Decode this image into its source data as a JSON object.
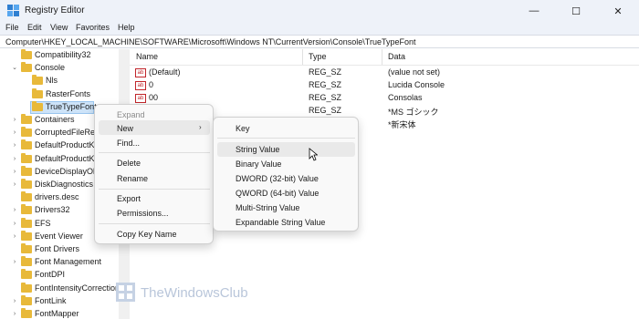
{
  "window": {
    "title": "Registry Editor",
    "minimize": "—",
    "maximize": "☐",
    "close": "✕"
  },
  "menu": {
    "file": "File",
    "edit": "Edit",
    "view": "View",
    "favorites": "Favorites",
    "help": "Help"
  },
  "address": "Computer\\HKEY_LOCAL_MACHINE\\SOFTWARE\\Microsoft\\Windows NT\\CurrentVersion\\Console\\TrueTypeFont",
  "tree": [
    {
      "label": "Compatibility32",
      "expander": "",
      "indent": 1,
      "selected": false
    },
    {
      "label": "Console",
      "expander": "open",
      "indent": 1,
      "selected": false
    },
    {
      "label": "Nls",
      "expander": "",
      "indent": 2,
      "selected": false
    },
    {
      "label": "RasterFonts",
      "expander": "",
      "indent": 2,
      "selected": false
    },
    {
      "label": "TrueTypeFont",
      "expander": "",
      "indent": 2,
      "selected": true
    },
    {
      "label": "Containers",
      "expander": "closed",
      "indent": 1,
      "selected": false
    },
    {
      "label": "CorruptedFileRe",
      "expander": "closed",
      "indent": 1,
      "selected": false
    },
    {
      "label": "DefaultProductK",
      "expander": "closed",
      "indent": 1,
      "selected": false
    },
    {
      "label": "DefaultProductK",
      "expander": "closed",
      "indent": 1,
      "selected": false
    },
    {
      "label": "DeviceDisplayOb",
      "expander": "closed",
      "indent": 1,
      "selected": false
    },
    {
      "label": "DiskDiagnostics",
      "expander": "closed",
      "indent": 1,
      "selected": false
    },
    {
      "label": "drivers.desc",
      "expander": "",
      "indent": 1,
      "selected": false
    },
    {
      "label": "Drivers32",
      "expander": "closed",
      "indent": 1,
      "selected": false
    },
    {
      "label": "EFS",
      "expander": "closed",
      "indent": 1,
      "selected": false
    },
    {
      "label": "Event Viewer",
      "expander": "closed",
      "indent": 1,
      "selected": false
    },
    {
      "label": "Font Drivers",
      "expander": "",
      "indent": 1,
      "selected": false
    },
    {
      "label": "Font Management",
      "expander": "closed",
      "indent": 1,
      "selected": false
    },
    {
      "label": "FontDPI",
      "expander": "",
      "indent": 1,
      "selected": false
    },
    {
      "label": "FontIntensityCorrection",
      "expander": "",
      "indent": 1,
      "selected": false
    },
    {
      "label": "FontLink",
      "expander": "closed",
      "indent": 1,
      "selected": false
    },
    {
      "label": "FontMapper",
      "expander": "closed",
      "indent": 1,
      "selected": false
    }
  ],
  "columns": {
    "name": "Name",
    "type": "Type",
    "data": "Data"
  },
  "values": [
    {
      "name": "(Default)",
      "type": "REG_SZ",
      "data": "(value not set)",
      "icon": "ab"
    },
    {
      "name": "0",
      "type": "REG_SZ",
      "data": "Lucida Console",
      "icon": "ab"
    },
    {
      "name": "00",
      "type": "REG_SZ",
      "data": "Consolas",
      "icon": "ab"
    },
    {
      "name": "",
      "type": "REG_SZ",
      "data": "*MS ゴシック",
      "icon": ""
    },
    {
      "name": "",
      "type": "",
      "data": "*新宋体",
      "icon": ""
    }
  ],
  "context_menu": {
    "expand": "Expand",
    "new": "New",
    "find": "Find...",
    "delete": "Delete",
    "rename": "Rename",
    "export": "Export",
    "permissions": "Permissions...",
    "copy_key_name": "Copy Key Name",
    "arrow": "›"
  },
  "new_submenu": {
    "key": "Key",
    "string_value": "String Value",
    "binary_value": "Binary Value",
    "dword_value": "DWORD (32-bit) Value",
    "qword_value": "QWORD (64-bit) Value",
    "multi_string_value": "Multi-String Value",
    "expandable_string_value": "Expandable String Value"
  },
  "watermark": {
    "text": "TheWindowsClub"
  },
  "colors": {
    "folder": "#e8b93a",
    "selection": "#cde3f8",
    "titlebar": "#eef2f9",
    "string_icon": "#c1252a"
  }
}
